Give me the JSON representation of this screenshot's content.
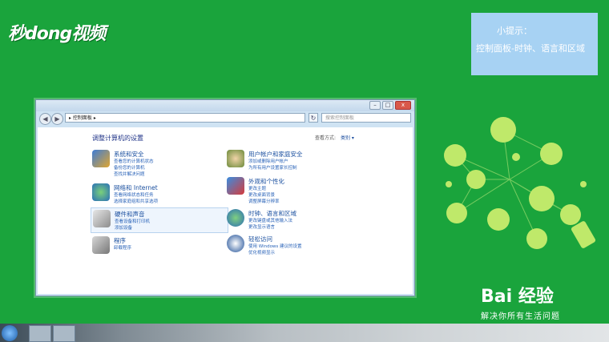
{
  "brand": {
    "logo_text": "秒dong视频"
  },
  "tip": {
    "title": "小提示：",
    "body": "控制面板-时钟、语言和区域"
  },
  "window": {
    "address": "▸ 控制面板 ▸",
    "search_placeholder": "搜索控制面板",
    "back": "◀",
    "forward": "▶",
    "refresh": "↻",
    "min": "–",
    "max": "□",
    "close": "x"
  },
  "panel": {
    "title": "调整计算机的设置",
    "view_by_label": "查看方式:",
    "view_by_value": "类别 ▾",
    "categories": [
      {
        "title": "系统和安全",
        "links": [
          "查看您的计算机状态",
          "备份您的计算机",
          "查找并解决问题"
        ]
      },
      {
        "title": "用户帐户和家庭安全",
        "links": [
          "添加或删除用户帐户",
          "为所有用户设置家长控制"
        ]
      },
      {
        "title": "网络和 Internet",
        "links": [
          "查看网络状态和任务",
          "选择家庭组和共享选项"
        ]
      },
      {
        "title": "外观和个性化",
        "links": [
          "更改主题",
          "更改桌面背景",
          "调整屏幕分辨率"
        ]
      },
      {
        "title": "硬件和声音",
        "links": [
          "查看设备和打印机",
          "添加设备"
        ]
      },
      {
        "title": "时钟、语言和区域",
        "links": [
          "更改键盘或其他输入法",
          "更改显示语言"
        ]
      },
      {
        "title": "程序",
        "links": [
          "卸载程序"
        ]
      },
      {
        "title": "轻松访问",
        "links": [
          "使用 Windows 建议的设置",
          "优化视频显示"
        ]
      }
    ]
  },
  "watermark": {
    "brand": "Bai 经验",
    "slogan": "解决你所有生活问题"
  },
  "colors": {
    "background": "#1aa43c",
    "tip_bg": "#a7d2f3",
    "link": "#1a4f9f"
  }
}
